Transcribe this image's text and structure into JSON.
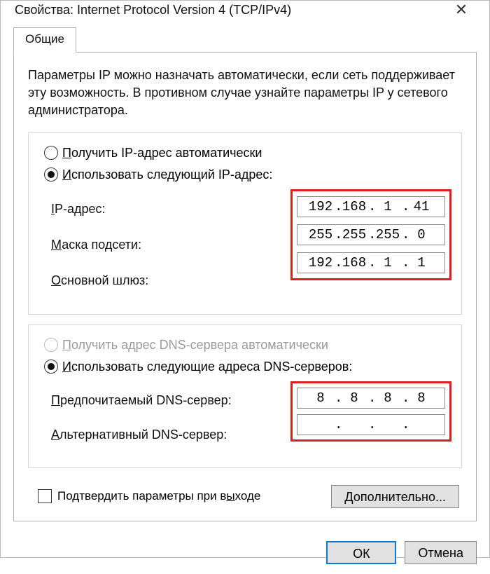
{
  "title": "Свойства: Internet Protocol Version 4 (TCP/IPv4)",
  "tab_general": "Общие",
  "intro_text": "Параметры IP можно назначать автоматически, если сеть поддерживает эту возможность. В противном случае узнайте параметры IP у сетевого администратора.",
  "ip_section": {
    "radio_auto_pre": "П",
    "radio_auto_rest": "олучить IP-адрес автоматически",
    "radio_manual_pre": "И",
    "radio_manual_rest": "спользовать следующий IP-адрес:",
    "label_ip_pre": "I",
    "label_ip_rest": "P-адрес:",
    "label_mask_pre": "М",
    "label_mask_rest": "аска подсети:",
    "label_gw_pre": "О",
    "label_gw_rest": "сновной шлюз:",
    "ip": {
      "o1": "192",
      "o2": "168",
      "o3": "1",
      "o4": "41"
    },
    "mask": {
      "o1": "255",
      "o2": "255",
      "o3": "255",
      "o4": "0"
    },
    "gw": {
      "o1": "192",
      "o2": "168",
      "o3": "1",
      "o4": "1"
    }
  },
  "dns_section": {
    "radio_auto_pre": "П",
    "radio_auto_rest": "олучить адрес DNS-сервера автоматически",
    "radio_manual_pre": "И",
    "radio_manual_rest": "спользовать следующие адреса DNS-серверов:",
    "label_pref_pre": "П",
    "label_pref_rest": "редпочитаемый DNS-сервер:",
    "label_alt_pre": "А",
    "label_alt_rest": "льтернативный DNS-сервер:",
    "pref": {
      "o1": "8",
      "o2": "8",
      "o3": "8",
      "o4": "8"
    },
    "alt": {
      "o1": "",
      "o2": "",
      "o3": "",
      "o4": ""
    }
  },
  "validate_label_pre": "Подтвердить параметры при в",
  "validate_label_und": "ы",
  "validate_label_rest": "ходе",
  "advanced_btn_pre": "Д",
  "advanced_btn_rest": "ополнительно...",
  "ok_btn": "ОК",
  "cancel_btn": "Отмена"
}
